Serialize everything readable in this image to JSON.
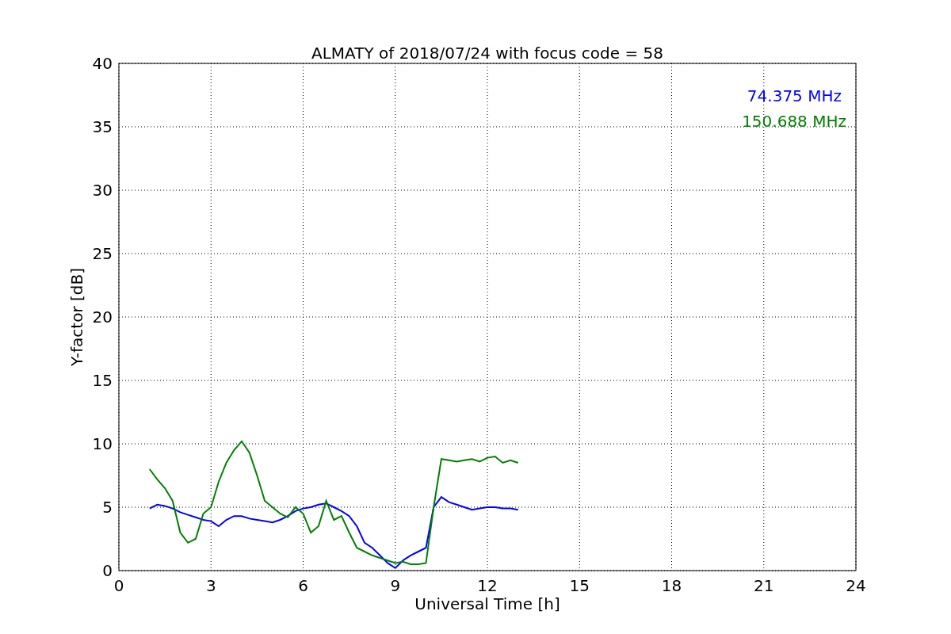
{
  "figure": {
    "chart_data": {
      "type": "line",
      "grid": true,
      "title": "ALMATY of 2018/07/24 with focus code = 58",
      "xlabel": "Universal Time [h]",
      "ylabel": "Y-factor [dB]",
      "xlim": [
        0,
        24
      ],
      "ylim": [
        0,
        40
      ],
      "xticks": [
        0,
        3,
        6,
        9,
        12,
        15,
        18,
        21,
        24
      ],
      "yticks": [
        0,
        5,
        10,
        15,
        20,
        25,
        30,
        35,
        40
      ],
      "x": [
        1,
        1.25,
        1.5,
        1.75,
        2,
        2.25,
        2.5,
        2.75,
        3,
        3.25,
        3.5,
        3.75,
        4,
        4.25,
        4.5,
        4.75,
        5,
        5.25,
        5.5,
        5.75,
        6,
        6.25,
        6.5,
        6.75,
        7,
        7.25,
        7.5,
        7.75,
        8,
        8.25,
        8.5,
        8.75,
        9,
        9.25,
        9.5,
        9.75,
        10,
        10.25,
        10.5,
        10.75,
        11,
        11.25,
        11.5,
        11.75,
        12,
        12.25,
        12.5,
        12.75,
        13
      ],
      "series": [
        {
          "name": "74.375 MHz",
          "color": "#0000ff",
          "values": [
            4.9,
            5.2,
            5.1,
            4.9,
            4.6,
            4.4,
            4.2,
            4.0,
            3.9,
            3.5,
            4.0,
            4.3,
            4.3,
            4.1,
            4.0,
            3.9,
            3.8,
            4.0,
            4.3,
            4.7,
            4.9,
            5.0,
            5.2,
            5.3,
            5.0,
            4.7,
            4.3,
            3.5,
            2.2,
            1.8,
            1.2,
            0.6,
            0.2,
            0.8,
            1.2,
            1.5,
            1.8,
            5.0,
            5.8,
            5.4,
            5.2,
            5.0,
            4.8,
            4.9,
            5.0,
            5.0,
            4.9,
            4.9,
            4.8
          ]
        },
        {
          "name": "150.688 MHz",
          "color": "#008000",
          "values": [
            8.0,
            7.2,
            6.5,
            5.5,
            3.0,
            2.2,
            2.5,
            4.5,
            5.0,
            7.0,
            8.5,
            9.5,
            10.2,
            9.3,
            7.5,
            5.5,
            5.0,
            4.5,
            4.2,
            5.0,
            4.5,
            3.0,
            3.5,
            5.5,
            4.0,
            4.3,
            3.0,
            1.8,
            1.5,
            1.2,
            1.0,
            0.8,
            0.6,
            0.7,
            0.5,
            0.5,
            0.6,
            5.0,
            8.8,
            8.7,
            8.6,
            8.7,
            8.8,
            8.6,
            8.9,
            9.0,
            8.5,
            8.7,
            8.5
          ]
        }
      ]
    }
  }
}
